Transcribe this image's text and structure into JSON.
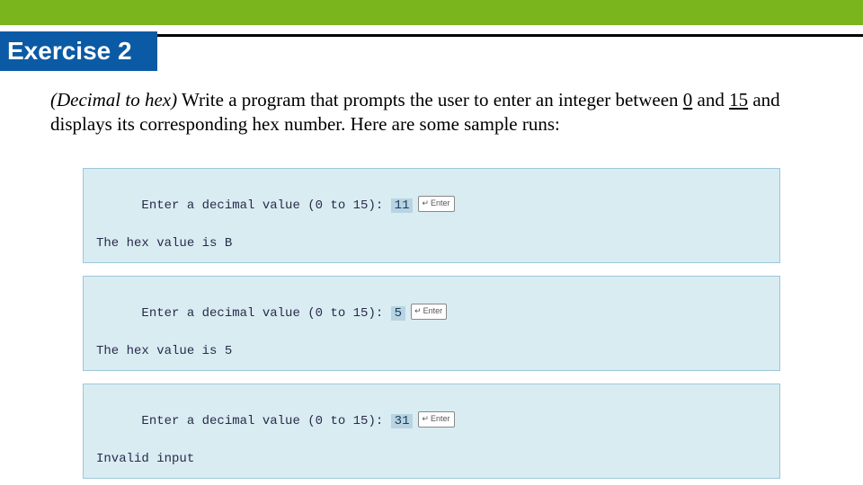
{
  "header": {
    "title": "Exercise 2"
  },
  "body": {
    "lead": "(Decimal to hex)",
    "text_part1": " Write a program that prompts the user to enter an integer between ",
    "low": "0",
    "text_part2": " and ",
    "high": "15",
    "text_part3": " and displays its corresponding hex number. Here are some sample runs:"
  },
  "runs": [
    {
      "prompt": "Enter a decimal value (0 to 15): ",
      "input": "11",
      "enter": "Enter",
      "result": "The hex value is B"
    },
    {
      "prompt": "Enter a decimal value (0 to 15): ",
      "input": "5",
      "enter": "Enter",
      "result": "The hex value is 5"
    },
    {
      "prompt": "Enter a decimal value (0 to 15): ",
      "input": "31",
      "enter": "Enter",
      "result": "Invalid input"
    }
  ]
}
